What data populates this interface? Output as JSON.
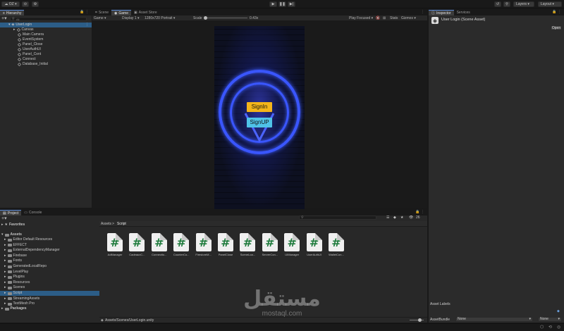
{
  "toolbar": {
    "account": "OZ",
    "layers": "Layers",
    "layout": "Layout",
    "play_icon": "play-icon",
    "pause_icon": "pause-icon",
    "step_icon": "step-icon"
  },
  "hierarchy": {
    "tab": "Hierarchy",
    "search_placeholder": "All",
    "scene": "UserLogin",
    "items": [
      "Canvas",
      "Main Camera",
      "EventSystem",
      "Panel_Close",
      "UserAuthUI",
      "Panel_Cont",
      "Connect",
      "Database_Initial"
    ]
  },
  "scene_tabs": {
    "scene": "Scene",
    "game": "Game",
    "asset_store": "Asset Store"
  },
  "game_toolbar": {
    "view_mode": "Game",
    "display": "Display 1",
    "resolution": "1280x720 Portrait",
    "scale_label": "Scale",
    "scale_value": "0.43x",
    "play_focused": "Play Focused",
    "stats": "Stats",
    "gizmos": "Gizmos"
  },
  "game": {
    "signin_label": "SignIn",
    "signup_label": "SignUP"
  },
  "project": {
    "tabs": {
      "project": "Project",
      "console": "Console"
    },
    "hidden_count": "26",
    "favorites": "Favorites",
    "assets_root": "Assets",
    "folders": [
      "Editor Default Resources",
      "EFFECT",
      "ExternalDependencyManager",
      "Firebase",
      "Fonts",
      "GeneratedLocalRepo",
      "LevelPlay",
      "Plugins",
      "Resources",
      "Scenes",
      "Script",
      "StreamingAssets",
      "TextMesh Pro"
    ],
    "selected_folder": "Script",
    "packages": "Packages",
    "breadcrumb": {
      "root": "Assets",
      "sep": ">",
      "current": "Script"
    },
    "files": [
      "AdManager",
      "CadeauxC...",
      "Connectio...",
      "CounterCo...",
      "FirestoreM...",
      "PanelClose",
      "SceneLoa...",
      "ServerCon...",
      "UIManager",
      "UserAuthUI",
      "WalletCon..."
    ],
    "file_glyph": "#",
    "status_path": "Assets/Scenes/UserLogin.unity"
  },
  "inspector": {
    "tabs": {
      "inspector": "Inspector",
      "services": "Services"
    },
    "title": "User Login (Scene Asset)",
    "open_button": "Open",
    "asset_labels": "Asset Labels",
    "asset_bundle_label": "AssetBundle",
    "bundle_value": "None",
    "variant_value": "None"
  },
  "watermark": {
    "brand": "مستقل",
    "domain": "mostaql.com"
  }
}
